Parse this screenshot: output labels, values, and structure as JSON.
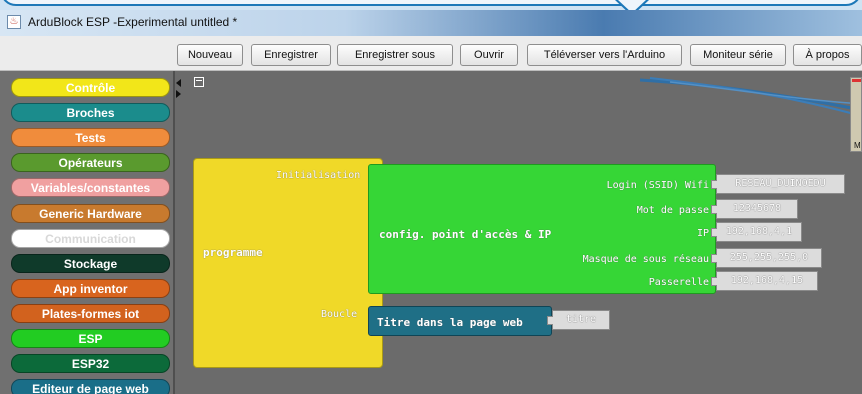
{
  "window": {
    "title": "ArduBlock ESP -Experimental untitled *"
  },
  "toolbar": {
    "buttons": [
      {
        "label": "Nouveau"
      },
      {
        "label": "Enregistrer"
      },
      {
        "label": "Enregistrer sous"
      },
      {
        "label": "Ouvrir"
      },
      {
        "label": "Téléverser vers l'Arduino"
      },
      {
        "label": "Moniteur série"
      },
      {
        "label": "À propos"
      }
    ]
  },
  "palette": {
    "categories": [
      {
        "label": "Contrôle",
        "color": "#f2e619"
      },
      {
        "label": "Broches",
        "color": "#1b8c8c"
      },
      {
        "label": "Tests",
        "color": "#f08c3c"
      },
      {
        "label": "Opérateurs",
        "color": "#5a9a2e"
      },
      {
        "label": "Variables/constantes",
        "color": "#f0a0a0"
      },
      {
        "label": "Generic Hardware",
        "color": "#c87a2e"
      },
      {
        "label": "Communication",
        "color": "#ffffff"
      },
      {
        "label": "Stockage",
        "color": "#0f3a2a"
      },
      {
        "label": "App inventor",
        "color": "#d8641e"
      },
      {
        "label": "Plates-formes iot",
        "color": "#d2621e"
      },
      {
        "label": "ESP",
        "color": "#22cc22"
      },
      {
        "label": "ESP32",
        "color": "#0c6a3a"
      },
      {
        "label": "Editeur de page web",
        "color": "#1a6e88"
      }
    ]
  },
  "canvas": {
    "program_block": {
      "label": "programme",
      "setup_label": "Initialisation",
      "loop_label": "Boucle",
      "color": "#f0d928"
    },
    "config_block": {
      "label": "config. point d'accès & IP",
      "color": "#36d636",
      "params": [
        {
          "name": "Login (SSID) Wifi",
          "value": "RESEAU_DUINOEDU"
        },
        {
          "name": "Mot de passe",
          "value": "12345678"
        },
        {
          "name": "IP",
          "value": "192,168,4,1"
        },
        {
          "name": "Masque de sous réseau",
          "value": "255,255,255,0"
        },
        {
          "name": "Passerelle",
          "value": "192,168,4,15"
        }
      ]
    },
    "title_block": {
      "label": "Titre dans la page web",
      "color": "#1f6f86",
      "value": "titre"
    }
  }
}
